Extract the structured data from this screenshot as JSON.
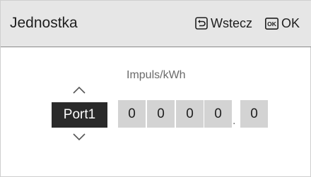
{
  "header": {
    "title": "Jednostka",
    "back_label": "Wstecz",
    "ok_icon_text": "OK",
    "ok_label": "OK"
  },
  "unit": {
    "label": "Impuls/kWh"
  },
  "port": {
    "selected": "Port1"
  },
  "value": {
    "digits": [
      "0",
      "0",
      "0",
      "0"
    ],
    "separator": ".",
    "decimal": "0"
  },
  "icons": {
    "back": "return-arrow-icon",
    "ok": "ok-key-icon",
    "up": "chevron-up-icon",
    "down": "chevron-down-icon"
  }
}
